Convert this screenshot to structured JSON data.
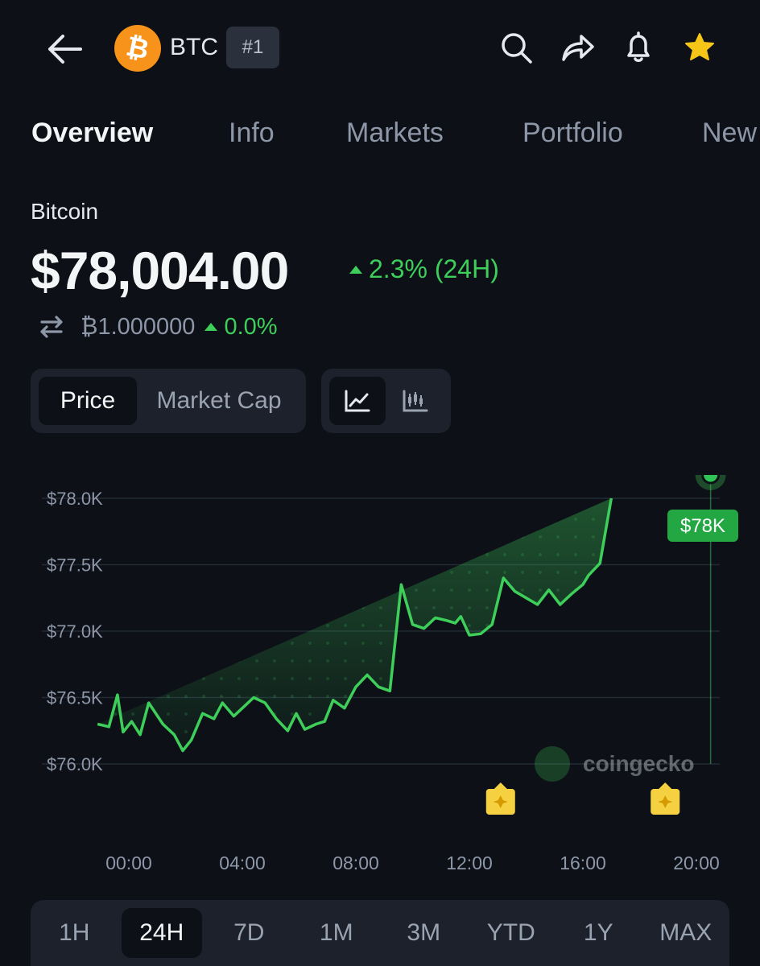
{
  "header": {
    "symbol": "BTC",
    "rank": "#1",
    "icons": [
      "back-arrow-icon",
      "bitcoin-logo-icon",
      "search-icon",
      "share-icon",
      "bell-icon",
      "star-icon"
    ],
    "star_color": "#f5c518"
  },
  "tabs": [
    "Overview",
    "Info",
    "Markets",
    "Portfolio",
    "New"
  ],
  "coin": {
    "name": "Bitcoin",
    "price": "$78,004.00",
    "change_24h": "2.3% (24H)",
    "btc_value": "₿1.000000",
    "btc_change": "0.0%"
  },
  "chart_toggle": {
    "price": "Price",
    "market_cap": "Market Cap",
    "views": [
      "line-chart-icon",
      "candlestick-chart-icon"
    ]
  },
  "colors": {
    "background": "#0d1117",
    "positive": "#3ecf5b",
    "surface": "#1c212b"
  },
  "chart_data": {
    "type": "line",
    "yticks": [
      "$78.0K",
      "$77.5K",
      "$77.0K",
      "$76.5K",
      "$76.0K"
    ],
    "ylim": [
      76000,
      78000
    ],
    "xticks": [
      "00:00",
      "04:00",
      "08:00",
      "12:00",
      "16:00",
      "20:00"
    ],
    "x": [
      -1.1,
      -0.7,
      -0.4,
      -0.2,
      0.1,
      0.4,
      0.7,
      1.2,
      1.6,
      1.9,
      2.2,
      2.6,
      3.0,
      3.3,
      3.7,
      4.0,
      4.4,
      4.8,
      5.2,
      5.6,
      5.9,
      6.2,
      6.6,
      6.9,
      7.2,
      7.6,
      8.0,
      8.4,
      8.8,
      9.2,
      9.6,
      10.0,
      10.4,
      10.8,
      11.2,
      11.5,
      11.7,
      12.0,
      12.4,
      12.8,
      13.2,
      13.6,
      14.0,
      14.4,
      14.8,
      15.2,
      15.6,
      16.0,
      16.2,
      16.6,
      17.0,
      17.4,
      17.8,
      18.2,
      18.6,
      19.0,
      19.4,
      19.8,
      20.2,
      20.5
    ],
    "values": [
      76300,
      76280,
      76520,
      76240,
      76320,
      76220,
      76460,
      76300,
      76220,
      76100,
      76180,
      76380,
      76340,
      76460,
      76360,
      76420,
      76500,
      76460,
      76340,
      76250,
      76380,
      76260,
      76300,
      76320,
      76480,
      76420,
      76580,
      76670,
      76580,
      76550,
      77350,
      77050,
      77020,
      77100,
      77080,
      77060,
      77110,
      76970,
      76980,
      77050,
      77400,
      77300,
      77250,
      77200,
      77310,
      77200,
      77280,
      77350,
      77420,
      77510,
      78000
    ],
    "last_point_label": "$78K",
    "series_color": "#3ecf5b",
    "event_markers_x": [
      13.1,
      18.9
    ],
    "watermark": "coingecko",
    "grid": true
  },
  "ranges": [
    "1H",
    "24H",
    "7D",
    "1M",
    "3M",
    "YTD",
    "1Y",
    "MAX"
  ],
  "active_range": "24H"
}
